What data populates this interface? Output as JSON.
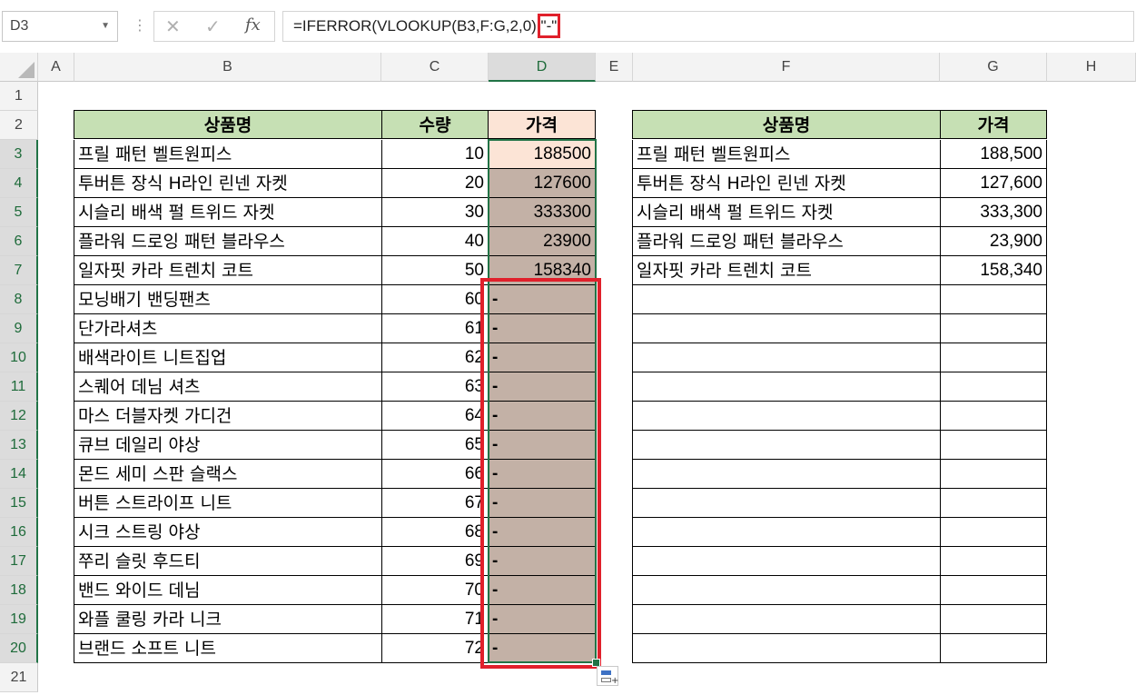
{
  "name_box": "D3",
  "formula_buttons": {
    "cancel": "✕",
    "enter": "✓",
    "fx": "fx"
  },
  "formula": {
    "before": "=IFERROR(VLOOKUP(B3,F:G,2,0),",
    "highlight": "\"-\""
  },
  "columns": [
    "A",
    "B",
    "C",
    "D",
    "E",
    "F",
    "G",
    "H"
  ],
  "rows": [
    "1",
    "2",
    "3",
    "4",
    "5",
    "6",
    "7",
    "8",
    "9",
    "10",
    "11",
    "12",
    "13",
    "14",
    "15",
    "16",
    "17",
    "18",
    "19",
    "20",
    "21"
  ],
  "left_table": {
    "headers": [
      "상품명",
      "수량",
      "가격"
    ],
    "rows": [
      {
        "name": "프릴 패턴 벨트원피스",
        "qty": "10",
        "price": "188500"
      },
      {
        "name": "투버튼 장식 H라인 린넨 자켓",
        "qty": "20",
        "price": "127600"
      },
      {
        "name": "시슬리 배색 펄 트위드 자켓",
        "qty": "30",
        "price": "333300"
      },
      {
        "name": "플라워 드로잉 패턴 블라우스",
        "qty": "40",
        "price": "23900"
      },
      {
        "name": "일자핏 카라 트렌치 코트",
        "qty": "50",
        "price": "158340"
      },
      {
        "name": "모닝배기 밴딩팬츠",
        "qty": "60",
        "price": "-"
      },
      {
        "name": "단가라셔츠",
        "qty": "61",
        "price": "-"
      },
      {
        "name": "배색라이트 니트집업",
        "qty": "62",
        "price": "-"
      },
      {
        "name": "스퀘어 데님 셔츠",
        "qty": "63",
        "price": "-"
      },
      {
        "name": "마스 더블자켓 가디건",
        "qty": "64",
        "price": "-"
      },
      {
        "name": "큐브 데일리 야상",
        "qty": "65",
        "price": "-"
      },
      {
        "name": "몬드 세미 스판 슬랙스",
        "qty": "66",
        "price": "-"
      },
      {
        "name": "버튼 스트라이프 니트",
        "qty": "67",
        "price": "-"
      },
      {
        "name": "시크 스트링 야상",
        "qty": "68",
        "price": "-"
      },
      {
        "name": "쭈리 슬릿 후드티",
        "qty": "69",
        "price": "-"
      },
      {
        "name": "밴드 와이드 데님",
        "qty": "70",
        "price": "-"
      },
      {
        "name": "와플 쿨링 카라 니크",
        "qty": "71",
        "price": "-"
      },
      {
        "name": "브랜드 소프트 니트",
        "qty": "72",
        "price": "-"
      }
    ]
  },
  "right_table": {
    "headers": [
      "상품명",
      "가격"
    ],
    "rows": [
      {
        "name": "프릴 패턴 벨트원피스",
        "price": "188,500"
      },
      {
        "name": "투버튼 장식 H라인 린넨 자켓",
        "price": "127,600"
      },
      {
        "name": "시슬리 배색 펄 트위드 자켓",
        "price": "333,300"
      },
      {
        "name": "플라워 드로잉 패턴 블라우스",
        "price": "23,900"
      },
      {
        "name": "일자핏 카라 트렌치 코트",
        "price": "158,340"
      },
      {
        "name": "",
        "price": ""
      },
      {
        "name": "",
        "price": ""
      },
      {
        "name": "",
        "price": ""
      },
      {
        "name": "",
        "price": ""
      },
      {
        "name": "",
        "price": ""
      },
      {
        "name": "",
        "price": ""
      },
      {
        "name": "",
        "price": ""
      },
      {
        "name": "",
        "price": ""
      },
      {
        "name": "",
        "price": ""
      },
      {
        "name": "",
        "price": ""
      },
      {
        "name": "",
        "price": ""
      },
      {
        "name": "",
        "price": ""
      },
      {
        "name": "",
        "price": ""
      }
    ]
  },
  "colors": {
    "header_green": "#c6e0b4",
    "header_peach": "#fce4d6",
    "selection_fill": "#c3b1a6",
    "highlight_red": "#e0202b",
    "excel_green": "#217346"
  }
}
